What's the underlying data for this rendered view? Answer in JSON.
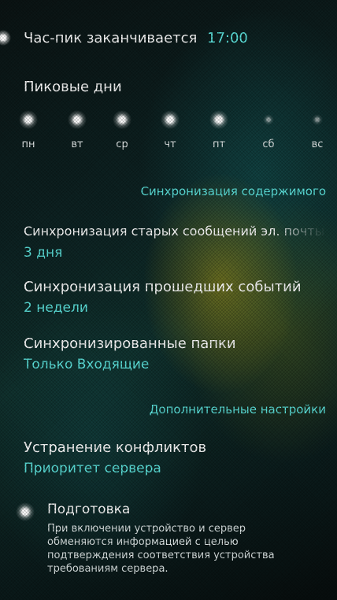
{
  "peak_end": {
    "label": "Час-пик заканчивается",
    "time": "17:00"
  },
  "peak_days": {
    "title": "Пиковые дни",
    "days": [
      {
        "label": "пн",
        "selected": true
      },
      {
        "label": "вт",
        "selected": true
      },
      {
        "label": "ср",
        "selected": true
      },
      {
        "label": "чт",
        "selected": true
      },
      {
        "label": "пт",
        "selected": true
      },
      {
        "label": "сб",
        "selected": false
      },
      {
        "label": "вс",
        "selected": false
      }
    ]
  },
  "sync_section": {
    "header": "Синхронизация содержимого",
    "old_mail_title": "Синхронизация старых сообщений эл. почты",
    "old_mail_value": "3 дня",
    "past_events_title": "Синхронизация прошедших событий",
    "past_events_value": "2 недели",
    "folders_title": "Синхронизированные папки",
    "folders_value": "Только Входящие"
  },
  "advanced_section": {
    "header": "Дополнительные настройки",
    "conflict_title": "Устранение конфликтов",
    "conflict_value": "Приоритет сервера",
    "provisioning_title": "Подготовка",
    "provisioning_enabled": true,
    "provisioning_desc": "При включении устройство и сервер обменяются информацией с целью подтверждения соответствия устройства требованиям сервера."
  },
  "colors": {
    "accent": "#5ee6e0",
    "text": "#ffffff"
  }
}
